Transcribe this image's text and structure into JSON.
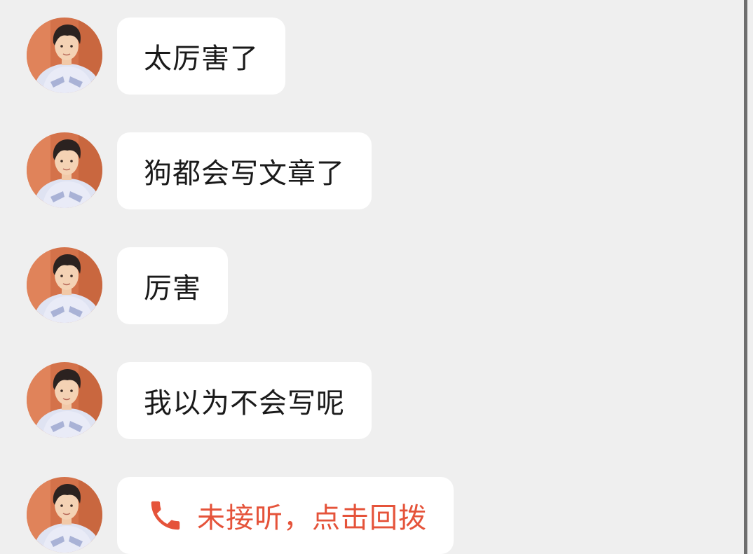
{
  "messages": [
    {
      "text": "太厉害了",
      "type": "text"
    },
    {
      "text": "狗都会写文章了",
      "type": "text"
    },
    {
      "text": "厉害",
      "type": "text"
    },
    {
      "text": "我以为不会写呢",
      "type": "text"
    },
    {
      "text": "未接听，点击回拨",
      "type": "missed-call",
      "icon": "phone-icon"
    }
  ],
  "colors": {
    "background": "#efefef",
    "bubble": "#ffffff",
    "text": "#1a1a1a",
    "missed_call": "#e5533a"
  }
}
